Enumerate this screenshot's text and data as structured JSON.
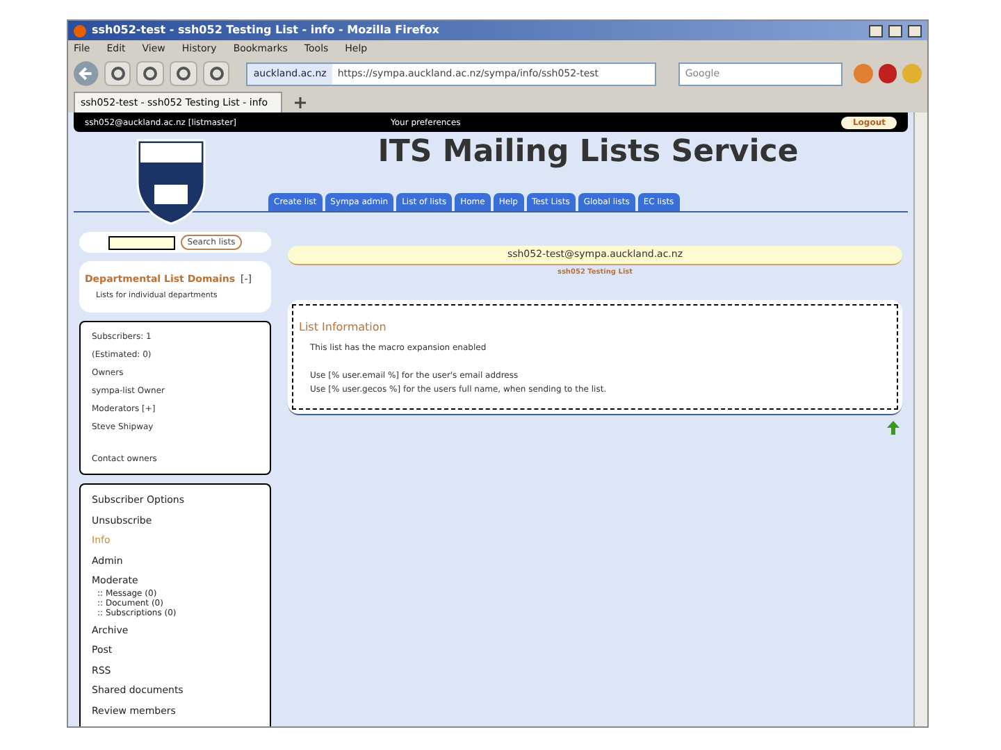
{
  "window": {
    "title": "ssh052-test - ssh052 Testing List - info - Mozilla Firefox"
  },
  "menu": [
    "File",
    "Edit",
    "View",
    "History",
    "Bookmarks",
    "Tools",
    "Help"
  ],
  "address": {
    "site": "auckland.ac.nz",
    "url": "https://sympa.auckland.ac.nz/sympa/info/ssh052-test"
  },
  "search": {
    "placeholder": "Google"
  },
  "browser_tabs": [
    {
      "label": "ssh052-test - ssh052 Testing List - info",
      "selected": true
    }
  ],
  "top_bar": {
    "user": "ssh052@auckland.ac.nz [listmaster]",
    "preferences": "Your preferences",
    "logout": "Logout"
  },
  "heading": "ITS Mailing Lists Service",
  "nav_tabs": [
    {
      "label": "Create list",
      "selected": false
    },
    {
      "label": "Sympa admin",
      "selected": false
    },
    {
      "label": "List of lists",
      "selected": false
    },
    {
      "label": "Home",
      "selected": false
    },
    {
      "label": "Help",
      "selected": false
    },
    {
      "label": "Test Lists",
      "selected": false
    },
    {
      "label": "Global lists",
      "selected": false
    },
    {
      "label": "EC lists",
      "selected": false
    }
  ],
  "search_lists": {
    "button": "Search lists"
  },
  "domains": {
    "title": "Departmental List Domains",
    "toggle": "[-]",
    "text": "Lists for individual departments"
  },
  "list_info": [
    {
      "kind": "label",
      "text": "Subscribers: 1"
    },
    {
      "kind": "value",
      "text": "(Estimated: 0)"
    },
    {
      "kind": "label",
      "text": "Owners"
    },
    {
      "kind": "value",
      "text": "sympa-list Owner"
    },
    {
      "kind": "label",
      "text": "Moderators [+]"
    },
    {
      "kind": "value",
      "text": "Steve Shipway"
    },
    {
      "kind": "link",
      "text": "Contact owners"
    }
  ],
  "list_menu": [
    {
      "label": "Subscriber Options",
      "selected": false
    },
    {
      "label": "Unsubscribe",
      "selected": false
    },
    {
      "label": "Info",
      "selected": true
    },
    {
      "label": "Admin",
      "selected": false
    },
    {
      "label": "Moderate",
      "selected": false,
      "children": [
        {
          "label": ":: Message (0)"
        },
        {
          "label": ":: Document (0)"
        },
        {
          "label": ":: Subscriptions (0)"
        }
      ]
    },
    {
      "label": "Archive",
      "selected": false
    },
    {
      "label": "Post",
      "selected": false
    },
    {
      "label": "RSS",
      "selected": false
    },
    {
      "label": "Shared documents",
      "selected": false
    },
    {
      "label": "Review members",
      "selected": false
    }
  ],
  "list_address": "ssh052-test@sympa.auckland.ac.nz",
  "list_subject": "ssh052 Testing List",
  "info_panel": {
    "title": "List Information",
    "paragraphs": [
      [
        "This list has the macro expansion enabled"
      ],
      [
        "Use [% user.email %] for the user's email address",
        "Use [% user.gecos %] for the users full name, when sending to the list."
      ]
    ]
  }
}
